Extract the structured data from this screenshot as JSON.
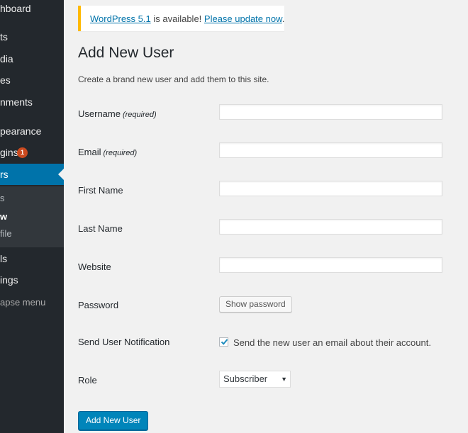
{
  "sidebar": {
    "items": [
      {
        "label": "hboard"
      },
      {
        "label": "ts"
      },
      {
        "label": "dia"
      },
      {
        "label": "es"
      },
      {
        "label": "nments"
      },
      {
        "label": "pearance"
      },
      {
        "label": "gins",
        "badge": "1"
      },
      {
        "label": "rs"
      },
      {
        "label": "ls"
      },
      {
        "label": "ings"
      }
    ],
    "submenu": [
      {
        "label": "s"
      },
      {
        "label": "w"
      },
      {
        "label": "file"
      }
    ],
    "collapse_label": "apse menu"
  },
  "notice": {
    "link1": "WordPress 5.1",
    "middle": " is available! ",
    "link2": "Please update now",
    "end": "."
  },
  "page": {
    "title": "Add New User",
    "description": "Create a brand new user and add them to this site."
  },
  "form": {
    "username_label": "Username",
    "username_req": "(required)",
    "email_label": "Email",
    "email_req": "(required)",
    "first_name_label": "First Name",
    "last_name_label": "Last Name",
    "website_label": "Website",
    "password_label": "Password",
    "show_password_button": "Show password",
    "notification_label": "Send User Notification",
    "notification_text": "Send the new user an email about their account.",
    "notification_checked": true,
    "role_label": "Role",
    "role_value": "Subscriber",
    "submit_button": "Add New User"
  },
  "colors": {
    "sidebar_bg": "#23282d",
    "accent": "#0073aa",
    "notice_border": "#ffb900",
    "badge": "#ca4a1f"
  }
}
